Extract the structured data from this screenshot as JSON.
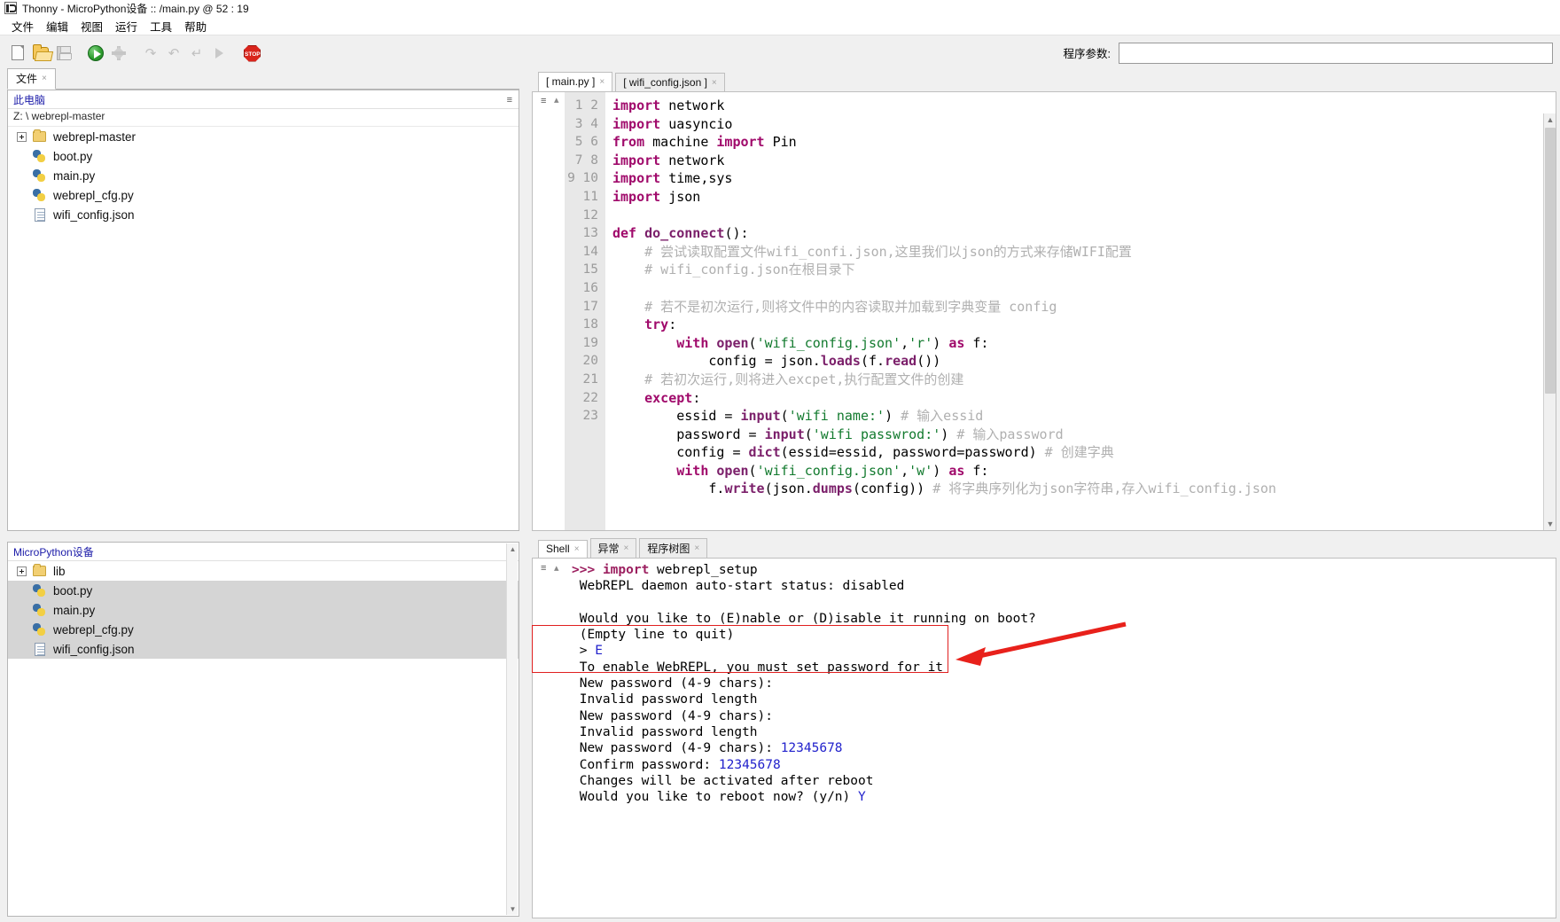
{
  "window": {
    "title": "Thonny  -  MicroPython设备 :: /main.py  @  52 : 19",
    "icon": "thonny-icon"
  },
  "menubar": {
    "items": [
      {
        "label": "文件",
        "name": "menu-file"
      },
      {
        "label": "编辑",
        "name": "menu-edit"
      },
      {
        "label": "视图",
        "name": "menu-view"
      },
      {
        "label": "运行",
        "name": "menu-run"
      },
      {
        "label": "工具",
        "name": "menu-tools"
      },
      {
        "label": "帮助",
        "name": "menu-help"
      }
    ]
  },
  "toolbar": {
    "buttons": [
      {
        "name": "new-file-icon",
        "title": "新建"
      },
      {
        "name": "open-file-icon",
        "title": "打开"
      },
      {
        "name": "save-file-icon",
        "title": "保存"
      },
      {
        "name": "run-icon",
        "title": "运行"
      },
      {
        "name": "debug-icon",
        "title": "调试"
      },
      {
        "name": "step-over-icon",
        "title": "跳过"
      },
      {
        "name": "step-into-icon",
        "title": "步入"
      },
      {
        "name": "step-out-icon",
        "title": "步出"
      },
      {
        "name": "resume-icon",
        "title": "继续"
      },
      {
        "name": "stop-icon",
        "title": "停止"
      }
    ],
    "stop_label": "STOP",
    "program_args_label": "程序参数:",
    "program_args_value": "",
    "program_args_placeholder": ""
  },
  "files_panel": {
    "tab_label": "文件",
    "tab_close": "×",
    "menu_glyph": "≡",
    "this_pc": "此电脑",
    "path": "Z: \\ webrepl-master",
    "items": [
      {
        "label": "webrepl-master",
        "icon": "folder-icon",
        "expandable": true,
        "indent": 0,
        "selected": false
      },
      {
        "label": "boot.py",
        "icon": "python-file-icon",
        "expandable": false,
        "indent": 1,
        "selected": false
      },
      {
        "label": "main.py",
        "icon": "python-file-icon",
        "expandable": false,
        "indent": 1,
        "selected": false
      },
      {
        "label": "webrepl_cfg.py",
        "icon": "python-file-icon",
        "expandable": false,
        "indent": 1,
        "selected": false
      },
      {
        "label": "wifi_config.json",
        "icon": "json-file-icon",
        "expandable": false,
        "indent": 1,
        "selected": false
      }
    ]
  },
  "device_panel": {
    "title": "MicroPython设备",
    "menu_glyph": "≡",
    "items": [
      {
        "label": "lib",
        "icon": "folder-icon",
        "expandable": true,
        "indent": 0,
        "selected": false
      },
      {
        "label": "boot.py",
        "icon": "python-file-icon",
        "expandable": false,
        "indent": 1,
        "selected": true
      },
      {
        "label": "main.py",
        "icon": "python-file-icon",
        "expandable": false,
        "indent": 1,
        "selected": true
      },
      {
        "label": "webrepl_cfg.py",
        "icon": "python-file-icon",
        "expandable": false,
        "indent": 1,
        "selected": true
      },
      {
        "label": "wifi_config.json",
        "icon": "json-file-icon",
        "expandable": false,
        "indent": 1,
        "selected": true
      }
    ]
  },
  "editor": {
    "tabs": [
      {
        "label": "[ main.py ]",
        "close": "×",
        "active": true
      },
      {
        "label": "[ wifi_config.json ]",
        "close": "×",
        "active": false
      }
    ],
    "gutter_menu": "≡",
    "gutter_chevron": "▴",
    "line_numbers": [
      "1",
      "2",
      "3",
      "4",
      "5",
      "6",
      "7",
      "8",
      "9",
      "10",
      "11",
      "12",
      "13",
      "14",
      "15",
      "16",
      "17",
      "18",
      "19",
      "20",
      "21",
      "22",
      "23"
    ],
    "lines": [
      "import network",
      "import uasyncio",
      "from machine import Pin",
      "import network",
      "import time,sys",
      "import json",
      "",
      "def do_connect():",
      "    # 尝试读取配置文件wifi_confi.json,这里我们以json的方式来存储WIFI配置",
      "    # wifi_config.json在根目录下",
      "",
      "    # 若不是初次运行,则将文件中的内容读取并加载到字典变量 config",
      "    try:",
      "        with open('wifi_config.json','r') as f:",
      "            config = json.loads(f.read())",
      "    # 若初次运行,则将进入excpet,执行配置文件的创建",
      "    except:",
      "        essid = input('wifi name:') # 输入essid",
      "        password = input('wifi passwrod:') # 输入password",
      "        config = dict(essid=essid, password=password) # 创建字典",
      "        with open('wifi_config.json','w') as f:",
      "            f.write(json.dumps(config)) # 将字典序列化为json字符串,存入wifi_config.json",
      ""
    ]
  },
  "shell": {
    "tabs": [
      {
        "label": "Shell",
        "close": "×",
        "active": true
      },
      {
        "label": "异常",
        "close": "×",
        "active": false
      },
      {
        "label": "程序树图",
        "close": "×",
        "active": false
      }
    ],
    "gutter_menu": "≡",
    "gutter_chevron": "▴",
    "prompt": ">>>",
    "command": "import webrepl_setup",
    "lines": [
      " WebREPL daemon auto-start status: disabled",
      "",
      " Would you like to (E)nable or (D)isable it running on boot?",
      " (Empty line to quit)",
      " > E",
      " To enable WebREPL, you must set password for it",
      " New password (4-9 chars):",
      " Invalid password length",
      " New password (4-9 chars):",
      " Invalid password length",
      " New password (4-9 chars): 12345678",
      " Confirm password: 12345678",
      " Changes will be activated after reboot",
      " Would you like to reboot now? (y/n) Y"
    ],
    "highlight_color": "#e02020",
    "arrow_color": "#e8211b"
  }
}
